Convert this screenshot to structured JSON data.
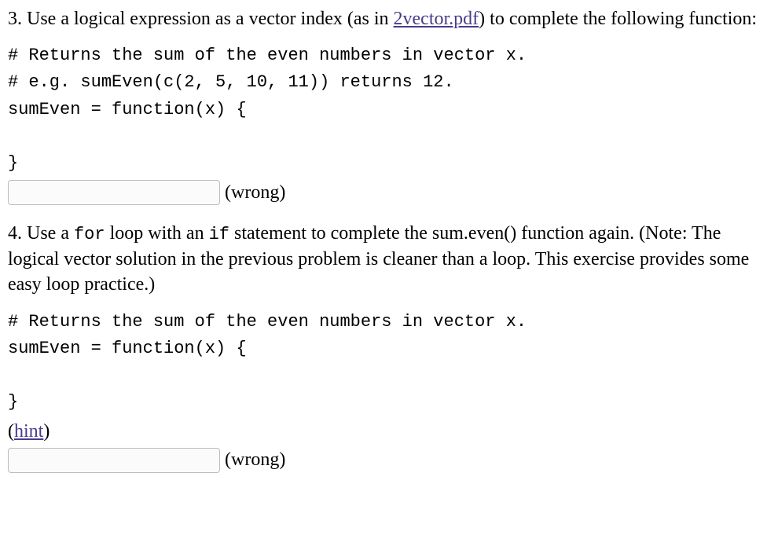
{
  "q3": {
    "prompt_before": "3. Use a logical expression as a vector index (as in ",
    "link_text": "2vector.pdf",
    "prompt_after": ") to complete the following function:",
    "code": "# Returns the sum of the even numbers in vector x.\n# e.g. sumEven(c(2, 5, 10, 11)) returns 12.\nsumEven = function(x) {\n\n}",
    "status": "(wrong)"
  },
  "q4": {
    "prompt_parts": {
      "a": "4. Use a ",
      "code1": "for",
      "b": " loop with an ",
      "code2": "if",
      "c": " statement to complete the sum.even() function again. (Note: The logical vector solution in the previous problem is cleaner than a loop. This exercise provides some easy loop practice.)"
    },
    "code": "# Returns the sum of the even numbers in vector x.\nsumEven = function(x) {\n\n}",
    "hint_label": "hint",
    "status": "(wrong)"
  }
}
